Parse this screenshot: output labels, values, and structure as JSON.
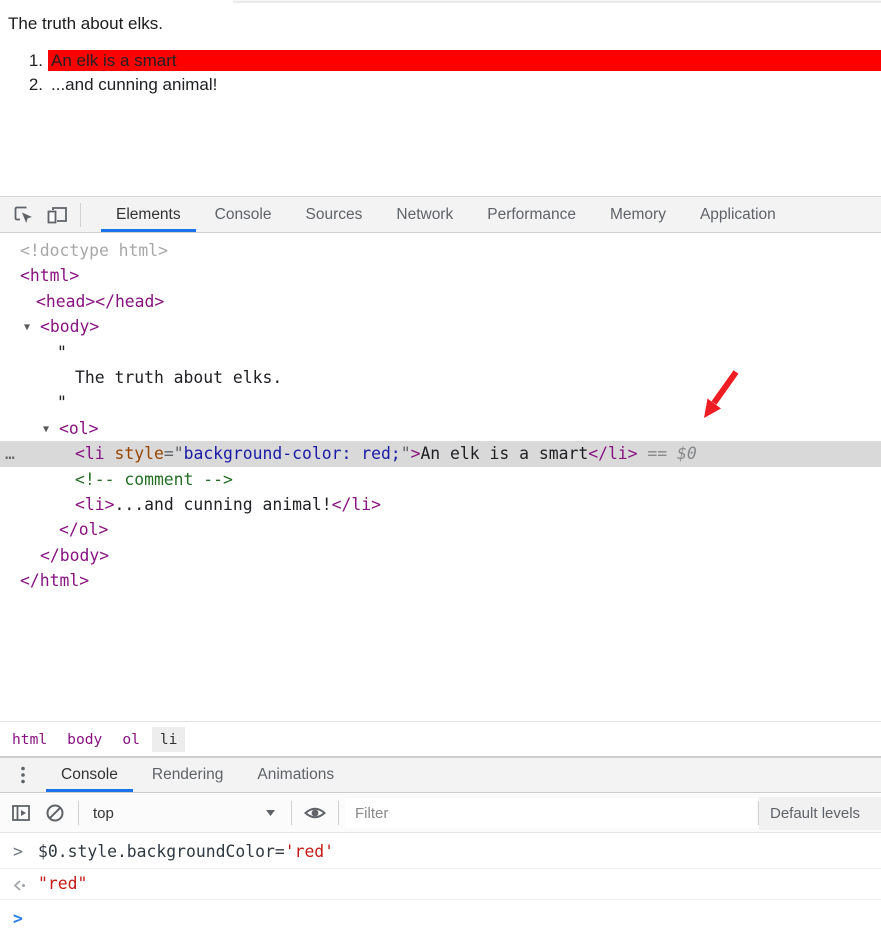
{
  "page": {
    "title": "The truth about elks.",
    "list": [
      {
        "number": "1.",
        "text": "An elk is a smart",
        "highlighted": true
      },
      {
        "number": "2.",
        "text": "...and cunning animal!",
        "highlighted": false
      }
    ]
  },
  "devtools": {
    "main_tabbar": {
      "icons": [
        "inspect-icon",
        "device-toolbar-icon"
      ],
      "tabs": [
        {
          "label": "Elements",
          "active": true
        },
        {
          "label": "Console",
          "active": false
        },
        {
          "label": "Sources",
          "active": false
        },
        {
          "label": "Network",
          "active": false
        },
        {
          "label": "Performance",
          "active": false
        },
        {
          "label": "Memory",
          "active": false
        },
        {
          "label": "Application",
          "active": false
        }
      ]
    },
    "dom_tree": {
      "lines": [
        {
          "indent": 20,
          "tokens": [
            [
              "gray",
              "<!doctype html>"
            ]
          ]
        },
        {
          "indent": 20,
          "tokens": [
            [
              "tag",
              "<html>"
            ]
          ]
        },
        {
          "indent": 36,
          "tokens": [
            [
              "tag",
              "<head></head>"
            ]
          ]
        },
        {
          "indent": 40,
          "expander": true,
          "tokens": [
            [
              "tag",
              "<body>"
            ]
          ]
        },
        {
          "indent": 57,
          "tokens": [
            [
              "text",
              "\""
            ]
          ]
        },
        {
          "indent": 75,
          "tokens": [
            [
              "text",
              "The truth about elks."
            ]
          ]
        },
        {
          "indent": 57,
          "tokens": [
            [
              "text",
              "\""
            ]
          ]
        },
        {
          "indent": 59,
          "expander": true,
          "tokens": [
            [
              "tag",
              "<ol>"
            ]
          ]
        },
        {
          "indent": 75,
          "highlighted": true,
          "gutter": "…",
          "tokens": [
            [
              "tag",
              "<li"
            ],
            [
              "punct",
              " "
            ],
            [
              "attr",
              "style"
            ],
            [
              "punct",
              "=\""
            ],
            [
              "val",
              "background-color: red;"
            ],
            [
              "punct",
              "\""
            ],
            [
              "tag",
              ">"
            ],
            [
              "text",
              "An elk is a smart"
            ],
            [
              "tag",
              "</li>"
            ],
            [
              "eq",
              " == "
            ],
            [
              "dollar",
              "$0"
            ]
          ]
        },
        {
          "indent": 75,
          "tokens": [
            [
              "comment",
              "<!-- comment -->"
            ]
          ]
        },
        {
          "indent": 75,
          "tokens": [
            [
              "tag",
              "<li>"
            ],
            [
              "text",
              "...and cunning animal!"
            ],
            [
              "tag",
              "</li>"
            ]
          ]
        },
        {
          "indent": 59,
          "tokens": [
            [
              "tag",
              "</ol>"
            ]
          ]
        },
        {
          "indent": 40,
          "tokens": [
            [
              "tag",
              "</body>"
            ]
          ]
        },
        {
          "indent": 20,
          "tokens": [
            [
              "tag",
              "</html>"
            ]
          ]
        }
      ]
    },
    "breadcrumbs": [
      {
        "label": "html",
        "selected": false
      },
      {
        "label": "body",
        "selected": false
      },
      {
        "label": "ol",
        "selected": false
      },
      {
        "label": "li",
        "selected": true
      }
    ],
    "drawer_tabbar": {
      "menu_icon": "three-dot-menu-icon",
      "tabs": [
        {
          "label": "Console",
          "active": true
        },
        {
          "label": "Rendering",
          "active": false
        },
        {
          "label": "Animations",
          "active": false
        }
      ]
    },
    "console": {
      "context_value": "top",
      "filter_placeholder": "Filter",
      "levels_value": "Default levels",
      "rows": [
        {
          "type": "input-echo",
          "icon": "chevron-right-icon",
          "tokens": [
            [
              "code",
              "$0.style.backgroundColor="
            ],
            [
              "string",
              "'red'"
            ]
          ]
        },
        {
          "type": "result",
          "icon": "return-arrow-icon",
          "tokens": [
            [
              "string",
              "\"red\""
            ]
          ]
        },
        {
          "type": "prompt",
          "icon": "chevron-right-icon",
          "tokens": []
        }
      ]
    }
  },
  "colors": {
    "list_highlight": "#ff0000",
    "annotation_arrow": "#ee1d23",
    "accent_blue": "#1a73e8",
    "tag_purple": "#881280",
    "attr_orange": "#994500",
    "attr_value_blue": "#1a1aa6",
    "comment_green": "#236e25",
    "console_string_red": "#c41a16",
    "selected_row_gray": "#d9d9d9"
  }
}
